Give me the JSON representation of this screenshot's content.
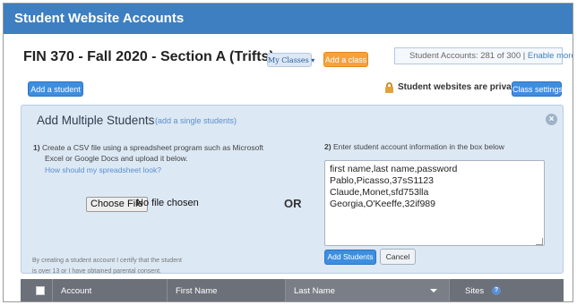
{
  "window": {
    "title": "Student Website Accounts"
  },
  "course": {
    "title": "FIN 370 - Fall 2020 - Section A (Trifts)",
    "my_classes_label": "My Classes ▾",
    "add_class_label": "Add a class",
    "accounts_text": "Student Accounts: 281 of 300 | ",
    "enable_more_label": "Enable more"
  },
  "toolbar": {
    "add_student_label": "Add a student",
    "private_text": "Student websites are private",
    "class_settings_label": "Class settings"
  },
  "panel": {
    "title": "Add Multiple Students",
    "single_link": "(add a single students)",
    "step1_num": "1)",
    "step1_text": "Create a CSV file using a spreadsheet program such as Microsoft",
    "step1_text2": "Excel or Google Docs and upload it below.",
    "spreadsheet_link": "How should my spreadsheet look?",
    "choose_file_label": "Choose File",
    "no_file_text": "No file chosen",
    "or_text": "OR",
    "step2_num": "2)",
    "step2_text": "Enter student account information in the box below",
    "csv_value": "first name,last name,password\nPablo,Picasso,37sS1123\nClaude,Monet,sfd753lla\nGeorgia,O'Keeffe,32if989",
    "add_students_label": "Add Students",
    "cancel_label": "Cancel",
    "certify_line1": "By creating a student account I certify that the student",
    "certify_line2": "is over 13 or I have obtained parental consent."
  },
  "table": {
    "columns": [
      "Account",
      "First Name",
      "Last Name",
      "Sites"
    ]
  },
  "colors": {
    "titlebar": "#3d7fc1",
    "primary_button": "#3d8ee0",
    "add_class_button": "#f5a23a",
    "panel_bg": "#dce8f4",
    "table_header": "#6b7079"
  }
}
